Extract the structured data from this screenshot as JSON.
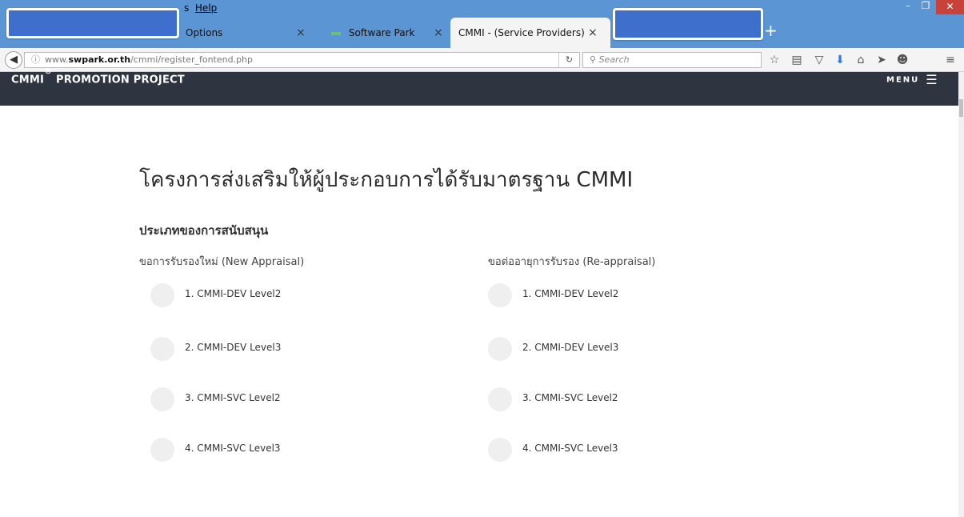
{
  "browser": {
    "menu_help_prefix": "s",
    "menu_help": "Help",
    "tabs": [
      {
        "label": "Options"
      },
      {
        "label": "Software Park Thailand"
      },
      {
        "label": "CMMI - (Service Providers)"
      }
    ],
    "close_glyph": "×",
    "new_tab_glyph": "+",
    "url_info": "ⓘ",
    "url_prefix": "www.",
    "url_host": "swpark.or.th",
    "url_path": "/cmmi/register_fontend.php",
    "search_placeholder": "Search",
    "window_buttons": {
      "minimize": "–",
      "maximize": "❐",
      "close": "✕"
    },
    "toolbar_icons": [
      "star-icon",
      "reading-list-icon",
      "pocket-icon",
      "download-icon",
      "home-icon",
      "send-icon",
      "emoji-icon",
      "hamburger-icon"
    ]
  },
  "site": {
    "logo": "CMMI",
    "logo_mark": "®",
    "logo_suffix": " PROMOTION PROJECT",
    "menu_label": "MENU"
  },
  "content": {
    "title": "โครงการส่งเสริมให้ผู้ประกอบการได้รับมาตรฐาน CMMI",
    "section": "ประเภทของการสนับสนุน",
    "new_appraisal": {
      "heading": "ขอการรับรองใหม่ (New Appraisal)",
      "options": [
        "1. CMMI-DEV Level2",
        "2. CMMI-DEV Level3",
        "3. CMMI-SVC Level2",
        "4. CMMI-SVC Level3"
      ]
    },
    "re_appraisal": {
      "heading": "ขอต่ออายุการรับรอง (Re-appraisal)",
      "options": [
        "1. CMMI-DEV Level2",
        "2. CMMI-DEV Level3",
        "3. CMMI-SVC Level2",
        "4. CMMI-SVC Level3"
      ]
    }
  },
  "colors": {
    "titlebar": "#5b95d4",
    "header": "#2f3540",
    "redaction": "#3f6fcc",
    "radio": "#efefef"
  }
}
